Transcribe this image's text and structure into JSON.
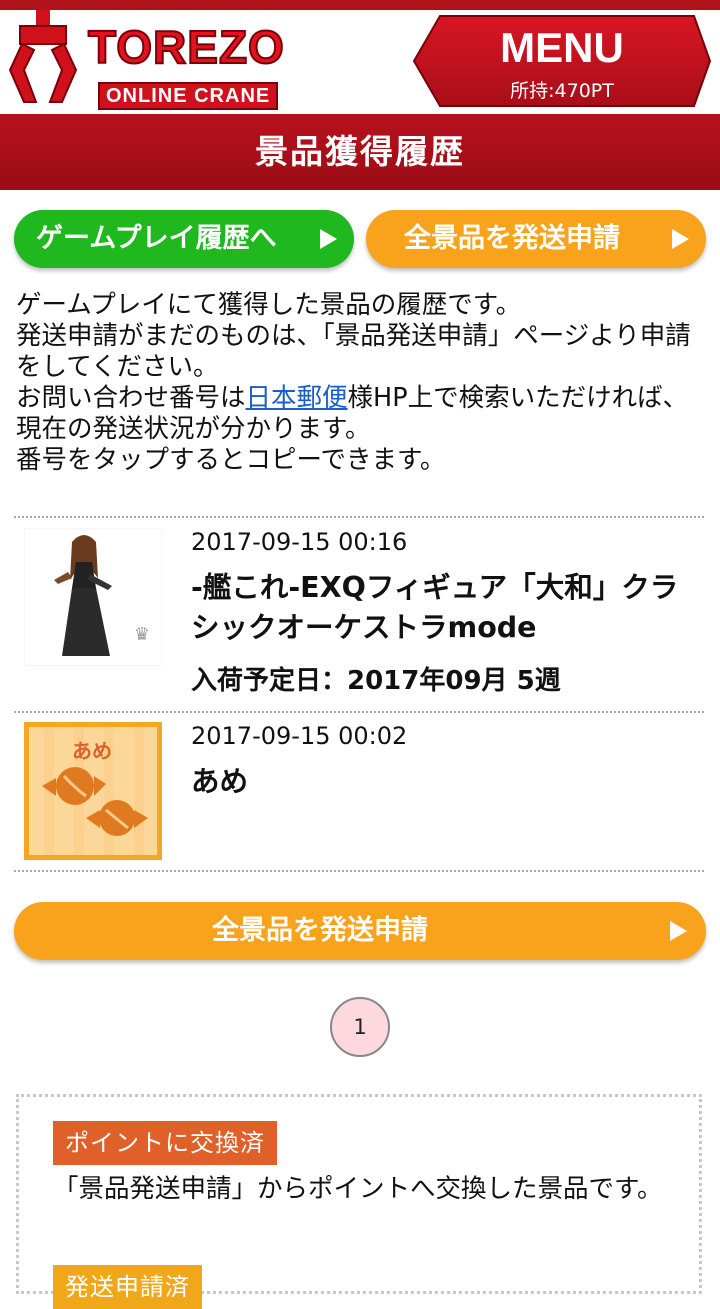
{
  "header": {
    "logo_word": "TOREZO",
    "logo_sub": "ONLINE CRANE",
    "menu_label": "MENU",
    "points": "所持:470PT"
  },
  "page": {
    "title": "景品獲得履歴"
  },
  "buttons": {
    "game_history": "ゲームプレイ履歴へ",
    "ship_all_top": "全景品を発送申請",
    "ship_all_bottom": "全景品を発送申請"
  },
  "description": {
    "line1": "ゲームプレイにて獲得した景品の履歴です。",
    "line2": "発送申請がまだのものは、「景品発送申請」ページより申請をしてください。",
    "line3_before": "お問い合わせ番号は",
    "line3_link": "日本郵便",
    "line3_after": "様HP上で検索いただければ、現在の発送状況が分かります。",
    "line4": "番号をタップするとコピーできます。"
  },
  "history": [
    {
      "date": "2017-09-15 00:16",
      "name": "-艦これ-EXQフィギュア「大和」クラシックオーケストラmode",
      "arrival": "入荷予定日：2017年09月 5週",
      "thumb_icon": "figure-image"
    },
    {
      "date": "2017-09-15 00:02",
      "name": "あめ",
      "thumb_label": "あめ",
      "thumb_icon": "candy-image"
    }
  ],
  "pagination": {
    "current": "1"
  },
  "legend": {
    "badge_exchanged": "ポイントに交換済",
    "exchanged_desc": "「景品発送申請」からポイントへ交換した景品です。",
    "badge_shipped": "発送申請済"
  },
  "colors": {
    "brand_red": "#b0121c",
    "green": "#1fb81f",
    "orange": "#f9a21b",
    "badge_exchanged": "#e0602a",
    "badge_shipped": "#f0a81a"
  }
}
